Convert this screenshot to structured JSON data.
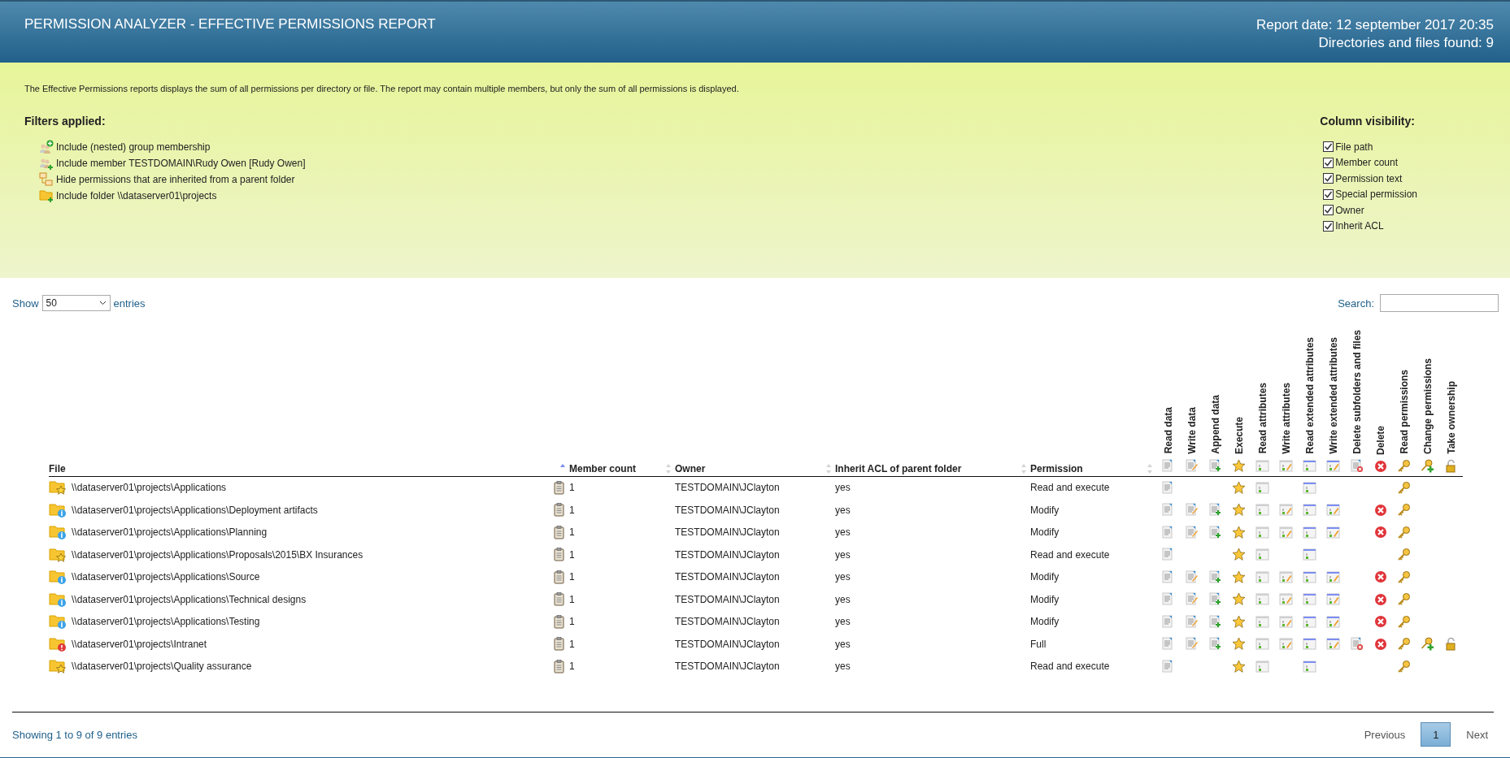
{
  "header": {
    "title": "PERMISSION ANALYZER - EFFECTIVE PERMISSIONS REPORT",
    "report_date": "Report date: 12 september 2017 20:35",
    "found": "Directories and files found: 9"
  },
  "description": "The Effective Permissions reports displays the sum of all permissions per directory or file. The report may contain multiple members, but only the sum of all permissions is displayed.",
  "filters": {
    "title": "Filters applied:",
    "items": [
      {
        "kind": "group",
        "label": "Include (nested) group membership"
      },
      {
        "kind": "member",
        "label": "Include member TESTDOMAIN\\Rudy Owen [Rudy Owen]"
      },
      {
        "kind": "inherit",
        "label": "Hide permissions that are inherited from a parent folder"
      },
      {
        "kind": "folder",
        "label": "Include folder \\\\dataserver01\\projects"
      }
    ]
  },
  "column_visibility": {
    "title": "Column visibility:",
    "items": [
      {
        "label": "File path",
        "checked": true
      },
      {
        "label": "Member count",
        "checked": true
      },
      {
        "label": "Permission text",
        "checked": true
      },
      {
        "label": "Special permission",
        "checked": true
      },
      {
        "label": "Owner",
        "checked": true
      },
      {
        "label": "Inherit ACL",
        "checked": true
      }
    ]
  },
  "length": {
    "before": "Show",
    "value": "50",
    "after": "entries"
  },
  "search": {
    "label": "Search:"
  },
  "table": {
    "columns": [
      {
        "label": "File",
        "sorted": true
      },
      {
        "label": "Member count",
        "sorted": false
      },
      {
        "label": "Owner",
        "sorted": false
      },
      {
        "label": "Inherit ACL of parent folder",
        "sorted": false
      },
      {
        "label": "Permission",
        "sorted": false
      }
    ],
    "perm_columns": [
      {
        "kind": "read_data",
        "label": "Read data"
      },
      {
        "kind": "write_data",
        "label": "Write data"
      },
      {
        "kind": "append_data",
        "label": "Append data"
      },
      {
        "kind": "execute",
        "label": "Execute"
      },
      {
        "kind": "read_attr",
        "label": "Read attributes"
      },
      {
        "kind": "write_attr",
        "label": "Write attributes"
      },
      {
        "kind": "read_ext",
        "label": "Read extended attributes"
      },
      {
        "kind": "write_ext",
        "label": "Write extended attributes"
      },
      {
        "kind": "delete_sub",
        "label": "Delete subfolders and files"
      },
      {
        "kind": "delete",
        "label": "Delete"
      },
      {
        "kind": "read_perm",
        "label": "Read permissions"
      },
      {
        "kind": "change_perm",
        "label": "Change permissions"
      },
      {
        "kind": "take_own",
        "label": "Take ownership"
      }
    ],
    "rows": [
      {
        "kind": "star",
        "path": "\\\\dataserver01\\projects\\Applications",
        "members": "1",
        "owner": "TESTDOMAIN\\JClayton",
        "inherit": "yes",
        "permission": "Read and execute",
        "granted": [
          true,
          false,
          false,
          true,
          true,
          false,
          true,
          false,
          false,
          false,
          true,
          false,
          false
        ]
      },
      {
        "kind": "info",
        "path": "\\\\dataserver01\\projects\\Applications\\Deployment artifacts",
        "members": "1",
        "owner": "TESTDOMAIN\\JClayton",
        "inherit": "yes",
        "permission": "Modify",
        "granted": [
          true,
          true,
          true,
          true,
          true,
          true,
          true,
          true,
          false,
          true,
          true,
          false,
          false
        ]
      },
      {
        "kind": "info",
        "path": "\\\\dataserver01\\projects\\Applications\\Planning",
        "members": "1",
        "owner": "TESTDOMAIN\\JClayton",
        "inherit": "yes",
        "permission": "Modify",
        "granted": [
          true,
          true,
          true,
          true,
          true,
          true,
          true,
          true,
          false,
          true,
          true,
          false,
          false
        ]
      },
      {
        "kind": "star",
        "path": "\\\\dataserver01\\projects\\Applications\\Proposals\\2015\\BX Insurances",
        "members": "1",
        "owner": "TESTDOMAIN\\JClayton",
        "inherit": "yes",
        "permission": "Read and execute",
        "granted": [
          true,
          false,
          false,
          true,
          true,
          false,
          true,
          false,
          false,
          false,
          true,
          false,
          false
        ]
      },
      {
        "kind": "info",
        "path": "\\\\dataserver01\\projects\\Applications\\Source",
        "members": "1",
        "owner": "TESTDOMAIN\\JClayton",
        "inherit": "yes",
        "permission": "Modify",
        "granted": [
          true,
          true,
          true,
          true,
          true,
          true,
          true,
          true,
          false,
          true,
          true,
          false,
          false
        ]
      },
      {
        "kind": "info",
        "path": "\\\\dataserver01\\projects\\Applications\\Technical designs",
        "members": "1",
        "owner": "TESTDOMAIN\\JClayton",
        "inherit": "yes",
        "permission": "Modify",
        "granted": [
          true,
          true,
          true,
          true,
          true,
          true,
          true,
          true,
          false,
          true,
          true,
          false,
          false
        ]
      },
      {
        "kind": "info",
        "path": "\\\\dataserver01\\projects\\Applications\\Testing",
        "members": "1",
        "owner": "TESTDOMAIN\\JClayton",
        "inherit": "yes",
        "permission": "Modify",
        "granted": [
          true,
          true,
          true,
          true,
          true,
          true,
          true,
          true,
          false,
          true,
          true,
          false,
          false
        ]
      },
      {
        "kind": "error",
        "path": "\\\\dataserver01\\projects\\Intranet",
        "members": "1",
        "owner": "TESTDOMAIN\\JClayton",
        "inherit": "yes",
        "permission": "Full",
        "granted": [
          true,
          true,
          true,
          true,
          true,
          true,
          true,
          true,
          true,
          true,
          true,
          true,
          true
        ]
      },
      {
        "kind": "star",
        "path": "\\\\dataserver01\\projects\\Quality assurance",
        "members": "1",
        "owner": "TESTDOMAIN\\JClayton",
        "inherit": "yes",
        "permission": "Read and execute",
        "granted": [
          true,
          false,
          false,
          true,
          true,
          false,
          true,
          false,
          false,
          false,
          true,
          false,
          false
        ]
      }
    ]
  },
  "footer": {
    "info": "Showing 1 to 9 of 9 entries",
    "pages": [
      {
        "label": "Previous",
        "selected": false
      },
      {
        "label": "1",
        "selected": true
      },
      {
        "label": "Next",
        "selected": false
      }
    ]
  }
}
